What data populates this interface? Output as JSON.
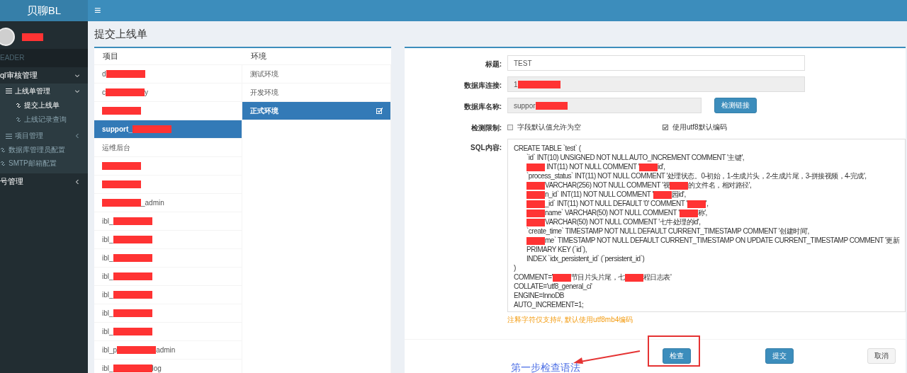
{
  "brand": "贝聊BL",
  "topbar": {
    "menu_glyph": "≡"
  },
  "user": {
    "redacted": true
  },
  "sidebar": {
    "items": [
      {
        "kind": "header",
        "label": "EADER"
      },
      {
        "kind": "section",
        "label": "ql审核管理",
        "expanded": true,
        "children": [
          {
            "kind": "group",
            "label": "上线单管理",
            "expanded": true,
            "children": [
              {
                "kind": "link",
                "label": "提交上线单",
                "selected": true
              },
              {
                "kind": "link",
                "label": "上线记录查询",
                "selected": false
              }
            ]
          },
          {
            "kind": "group",
            "label": "项目管理",
            "expanded": false
          },
          {
            "kind": "link",
            "label": "数据库管理员配置",
            "selected": false
          },
          {
            "kind": "link",
            "label": "SMTP邮箱配置",
            "selected": false
          }
        ]
      },
      {
        "kind": "section",
        "label": "号管理",
        "expanded": false
      }
    ]
  },
  "page_title": "提交上线单",
  "projects": {
    "heading": "项目",
    "items": [
      {
        "selected": false,
        "parts": [
          {
            "kind": "text",
            "text": "d"
          },
          {
            "kind": "redaction"
          }
        ]
      },
      {
        "selected": false,
        "parts": [
          {
            "kind": "text",
            "text": "c"
          },
          {
            "kind": "redaction"
          },
          {
            "kind": "text",
            "text": "y"
          }
        ]
      },
      {
        "selected": false,
        "parts": [
          {
            "kind": "redaction"
          }
        ]
      },
      {
        "selected": true,
        "parts": [
          {
            "kind": "text",
            "text": "support_"
          },
          {
            "kind": "redaction"
          }
        ]
      },
      {
        "selected": false,
        "parts": [
          {
            "kind": "text",
            "text": "运维后台"
          }
        ]
      },
      {
        "selected": false,
        "parts": [
          {
            "kind": "redaction"
          }
        ]
      },
      {
        "selected": false,
        "parts": [
          {
            "kind": "redaction"
          }
        ]
      },
      {
        "selected": false,
        "parts": [
          {
            "kind": "redaction"
          },
          {
            "kind": "text",
            "text": "_admin"
          }
        ]
      },
      {
        "selected": false,
        "parts": [
          {
            "kind": "text",
            "text": "ibl_"
          },
          {
            "kind": "redaction"
          }
        ]
      },
      {
        "selected": false,
        "parts": [
          {
            "kind": "text",
            "text": "ibl_"
          },
          {
            "kind": "redaction"
          }
        ]
      },
      {
        "selected": false,
        "parts": [
          {
            "kind": "text",
            "text": "ibl_"
          },
          {
            "kind": "redaction"
          }
        ]
      },
      {
        "selected": false,
        "parts": [
          {
            "kind": "text",
            "text": "ibl_"
          },
          {
            "kind": "redaction"
          }
        ]
      },
      {
        "selected": false,
        "parts": [
          {
            "kind": "text",
            "text": "ibl_"
          },
          {
            "kind": "redaction"
          }
        ]
      },
      {
        "selected": false,
        "parts": [
          {
            "kind": "text",
            "text": "ibl_"
          },
          {
            "kind": "redaction"
          }
        ]
      },
      {
        "selected": false,
        "parts": [
          {
            "kind": "text",
            "text": "ibl_"
          },
          {
            "kind": "redaction"
          }
        ]
      },
      {
        "selected": false,
        "parts": [
          {
            "kind": "text",
            "text": "ibl_p"
          },
          {
            "kind": "redaction"
          },
          {
            "kind": "text",
            "text": "admin"
          }
        ]
      },
      {
        "selected": false,
        "parts": [
          {
            "kind": "text",
            "text": "ibl_"
          },
          {
            "kind": "redaction"
          },
          {
            "kind": "text",
            "text": "log"
          }
        ]
      }
    ]
  },
  "environments": {
    "heading": "环境",
    "items": [
      {
        "label": "测试环境",
        "selected": false
      },
      {
        "label": "开发环境",
        "selected": false
      },
      {
        "label": "正式环境",
        "selected": true
      }
    ]
  },
  "form": {
    "title": {
      "label": "标题:",
      "value": "TEST"
    },
    "db_connection": {
      "label": "数据库连接:",
      "parts": [
        {
          "kind": "text",
          "text": "1"
        },
        {
          "kind": "redaction"
        }
      ]
    },
    "db_name": {
      "label": "数据库名称:",
      "parts": [
        {
          "kind": "text",
          "text": "suppor"
        },
        {
          "kind": "redaction"
        }
      ],
      "button": "检测链接"
    },
    "limits": {
      "label": "检测限制:",
      "options": [
        {
          "label": "字段默认值允许为空",
          "checked": false
        },
        {
          "label": "使用utf8默认编码",
          "checked": true
        }
      ]
    },
    "sql": {
      "label": "SQL内容:",
      "lines": [
        {
          "kind": "plain",
          "parts": [
            {
              "kind": "text",
              "text": "CREATE TABLE `test` ("
            }
          ]
        },
        {
          "kind": "column",
          "parts": [
            {
              "kind": "text",
              "text": "`id` INT(10) UNSIGNED NOT NULL AUTO_INCREMENT COMMENT '主键',"
            }
          ]
        },
        {
          "kind": "column",
          "parts": [
            {
              "kind": "redaction"
            },
            {
              "kind": "text",
              "text": " INT(11) NOT NULL COMMENT '"
            },
            {
              "kind": "redaction"
            },
            {
              "kind": "text",
              "text": "id',"
            }
          ]
        },
        {
          "kind": "column",
          "parts": [
            {
              "kind": "text",
              "text": "`process_status` INT(11) NOT NULL COMMENT '处理状态。0-初始，1-生成片头，2-生成片尾，3-拼接视频，4-完成',"
            }
          ]
        },
        {
          "kind": "column",
          "parts": [
            {
              "kind": "redaction"
            },
            {
              "kind": "text",
              "text": "VARCHAR(256) NOT NULL COMMENT '视"
            },
            {
              "kind": "redaction"
            },
            {
              "kind": "text",
              "text": "的文件名，相对路径',"
            }
          ]
        },
        {
          "kind": "column",
          "parts": [
            {
              "kind": "redaction"
            },
            {
              "kind": "text",
              "text": "n_id` INT(11) NOT NULL COMMENT '"
            },
            {
              "kind": "redaction"
            },
            {
              "kind": "text",
              "text": "园id',"
            }
          ]
        },
        {
          "kind": "column",
          "parts": [
            {
              "kind": "redaction"
            },
            {
              "kind": "text",
              "text": "_id` INT(11) NOT NULL DEFAULT '0' COMMENT '"
            },
            {
              "kind": "redaction"
            },
            {
              "kind": "text",
              "text": "',"
            }
          ]
        },
        {
          "kind": "column",
          "parts": [
            {
              "kind": "redaction"
            },
            {
              "kind": "text",
              "text": "name` VARCHAR(50) NOT NULL COMMENT '"
            },
            {
              "kind": "redaction"
            },
            {
              "kind": "text",
              "text": "称',"
            }
          ]
        },
        {
          "kind": "column",
          "parts": [
            {
              "kind": "redaction"
            },
            {
              "kind": "text",
              "text": "VARCHAR(50) NOT NULL COMMENT '七牛处理的id',"
            }
          ]
        },
        {
          "kind": "column",
          "parts": [
            {
              "kind": "text",
              "text": "`create_time` TIMESTAMP NOT NULL DEFAULT CURRENT_TIMESTAMP COMMENT '创建时间',"
            }
          ]
        },
        {
          "kind": "column",
          "parts": [
            {
              "kind": "redaction"
            },
            {
              "kind": "text",
              "text": "me` TIMESTAMP NOT NULL DEFAULT CURRENT_TIMESTAMP ON UPDATE CURRENT_TIMESTAMP COMMENT '更新"
            }
          ]
        },
        {
          "kind": "column",
          "parts": [
            {
              "kind": "text",
              "text": "PRIMARY KEY (`id`),"
            }
          ]
        },
        {
          "kind": "column",
          "parts": [
            {
              "kind": "text",
              "text": "INDEX `idx_persistent_id` (`persistent_id`)"
            }
          ]
        },
        {
          "kind": "plain",
          "parts": [
            {
              "kind": "text",
              "text": ")"
            }
          ]
        },
        {
          "kind": "plain",
          "parts": [
            {
              "kind": "text",
              "text": "COMMENT='"
            },
            {
              "kind": "redaction"
            },
            {
              "kind": "text",
              "text": "节目片头片尾，七"
            },
            {
              "kind": "redaction"
            },
            {
              "kind": "text",
              "text": "程日志表'"
            }
          ]
        },
        {
          "kind": "plain",
          "parts": [
            {
              "kind": "text",
              "text": "COLLATE='utf8_general_ci'"
            }
          ]
        },
        {
          "kind": "plain",
          "parts": [
            {
              "kind": "text",
              "text": "ENGINE=InnoDB"
            }
          ]
        },
        {
          "kind": "plain",
          "parts": [
            {
              "kind": "text",
              "text": "AUTO_INCREMENT=1;"
            }
          ]
        }
      ]
    },
    "hint": "注释字符仅支持#, 默认使用utf8mb4编码"
  },
  "buttons": [
    {
      "kind": "primary",
      "label": "检查"
    },
    {
      "kind": "primary",
      "label": "提交"
    },
    {
      "kind": "default",
      "label": "取消"
    }
  ],
  "annotation": {
    "text": "第一步检查语法"
  }
}
